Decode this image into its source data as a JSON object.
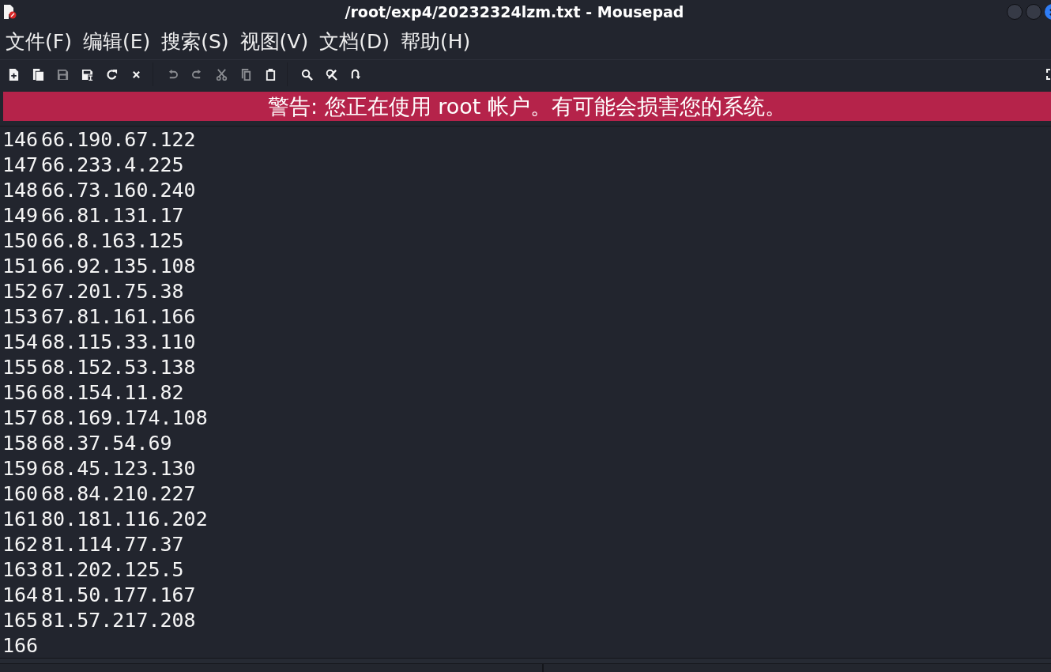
{
  "window": {
    "title": "/root/exp4/20232324lzm.txt - Mousepad"
  },
  "menu": [
    "文件(F)",
    "编辑(E)",
    "搜索(S)",
    "视图(V)",
    "文档(D)",
    "帮助(H)"
  ],
  "toolbar": {
    "groups": [
      {
        "items": [
          {
            "kind": "new",
            "disabled": false
          },
          {
            "kind": "new_window",
            "disabled": false
          },
          {
            "kind": "save",
            "disabled": true
          },
          {
            "kind": "save_as",
            "disabled": false
          },
          {
            "kind": "reload",
            "disabled": false
          },
          {
            "kind": "close",
            "disabled": false
          }
        ]
      },
      {
        "items": [
          {
            "kind": "undo",
            "disabled": true
          },
          {
            "kind": "redo",
            "disabled": true
          },
          {
            "kind": "cut",
            "disabled": true
          },
          {
            "kind": "copy",
            "disabled": true
          },
          {
            "kind": "paste",
            "disabled": false
          }
        ]
      },
      {
        "items": [
          {
            "kind": "find",
            "disabled": false
          },
          {
            "kind": "replace",
            "disabled": false
          },
          {
            "kind": "goto",
            "disabled": false
          }
        ]
      }
    ]
  },
  "warning": "警告: 您正在使用 root 帐户。有可能会损害您的系统。",
  "editor": {
    "lines": [
      {
        "number": "146",
        "text": "66.190.67.122"
      },
      {
        "number": "147",
        "text": "66.233.4.225"
      },
      {
        "number": "148",
        "text": "66.73.160.240"
      },
      {
        "number": "149",
        "text": "66.81.131.17"
      },
      {
        "number": "150",
        "text": "66.8.163.125"
      },
      {
        "number": "151",
        "text": "66.92.135.108"
      },
      {
        "number": "152",
        "text": "67.201.75.38"
      },
      {
        "number": "153",
        "text": "67.81.161.166"
      },
      {
        "number": "154",
        "text": "68.115.33.110"
      },
      {
        "number": "155",
        "text": "68.152.53.138"
      },
      {
        "number": "156",
        "text": "68.154.11.82"
      },
      {
        "number": "157",
        "text": "68.169.174.108"
      },
      {
        "number": "158",
        "text": "68.37.54.69"
      },
      {
        "number": "159",
        "text": "68.45.123.130"
      },
      {
        "number": "160",
        "text": "68.84.210.227"
      },
      {
        "number": "161",
        "text": "80.181.116.202"
      },
      {
        "number": "162",
        "text": "81.114.77.37"
      },
      {
        "number": "163",
        "text": "81.202.125.5"
      },
      {
        "number": "164",
        "text": "81.50.177.167"
      },
      {
        "number": "165",
        "text": "81.57.217.208"
      },
      {
        "number": "166"
      }
    ]
  }
}
